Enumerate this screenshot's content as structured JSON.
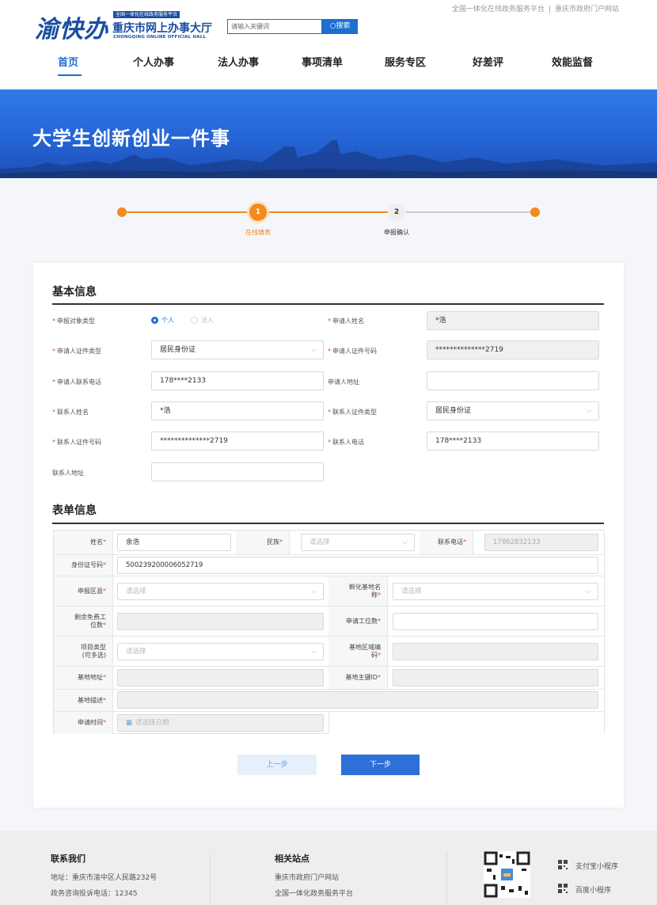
{
  "header": {
    "logo_text": "渝快办",
    "logo_tag": "全国一体化在线政务服务平台",
    "site_title": "重庆市网上办事大厅",
    "site_subtitle": "CHONGQING ONLINE OFFICIAL HALL",
    "search_placeholder": "请输入关键词",
    "search_button": "搜索",
    "top_links": [
      "全国一体化在线政务服务平台",
      "重庆市政府门户网站"
    ],
    "nav": [
      "首页",
      "个人办事",
      "法人办事",
      "事项清单",
      "服务专区",
      "好差评",
      "效能监督"
    ]
  },
  "banner": {
    "title": "大学生创新创业一件事"
  },
  "steps": [
    {
      "num": "1",
      "label": "在线填表"
    },
    {
      "num": "2",
      "label": "申报确认"
    }
  ],
  "basic": {
    "title": "基本信息",
    "labels": {
      "type": "申报对象类型",
      "name": "申请人姓名",
      "id_type": "申请人证件类型",
      "id_no": "申请人证件号码",
      "phone": "申请人联系电话",
      "address": "申请人地址",
      "contact_name": "联系人姓名",
      "contact_id_type": "联系人证件类型",
      "contact_id_no": "联系人证件号码",
      "contact_phone": "联系人电话",
      "contact_address": "联系人地址"
    },
    "radio_personal": "个人",
    "radio_legal": "法人",
    "values": {
      "name": "*浩",
      "id_type": "居民身份证",
      "id_no": "**************2719",
      "phone": "178****2133",
      "address": "",
      "contact_name": "*浩",
      "contact_id_type": "居民身份证",
      "contact_id_no": "**************2719",
      "contact_phone": "178****2133",
      "contact_address": ""
    }
  },
  "form": {
    "title": "表单信息",
    "labels": {
      "name": "姓名",
      "ethnic": "民族",
      "phone": "联系电话",
      "id_no": "身份证号码",
      "district": "申报区县",
      "base_name_1": "孵化基地名",
      "base_name_2": "称",
      "free_seats_1": "剩余免费工",
      "free_seats_2": "位数",
      "apply_seats": "申请工位数",
      "project_type_1": "项目类型",
      "project_type_2": "(可多选)",
      "area_code_1": "基地区域编",
      "area_code_2": "码",
      "base_address": "基地地址",
      "base_id": "基地主键ID",
      "base_desc": "基地描述",
      "apply_time": "申请时间"
    },
    "values": {
      "name": "余浩",
      "ethnic_ph": "请选择",
      "phone": "17862832133",
      "id_no": "500239200006052719",
      "district_ph": "请选择",
      "base_name_ph": "请选择",
      "project_type_ph": "请选择",
      "apply_time_ph": "请选择日期"
    }
  },
  "buttons": {
    "prev": "上一步",
    "next": "下一步"
  },
  "footer": {
    "contact_title": "联系我们",
    "address": "地址：重庆市渝中区人民路232号",
    "hotline": "政务咨询投诉电话：12345",
    "sites_title": "相关站点",
    "site1": "重庆市政府门户网站",
    "site2": "全国一体化政务服务平台",
    "mini1": "支付宝小程序",
    "mini2": "百度小程序"
  },
  "colors": {
    "primary": "#1a6fd1",
    "orange": "#f28a1e",
    "banner": "#2565d6",
    "required": "#e44444"
  }
}
